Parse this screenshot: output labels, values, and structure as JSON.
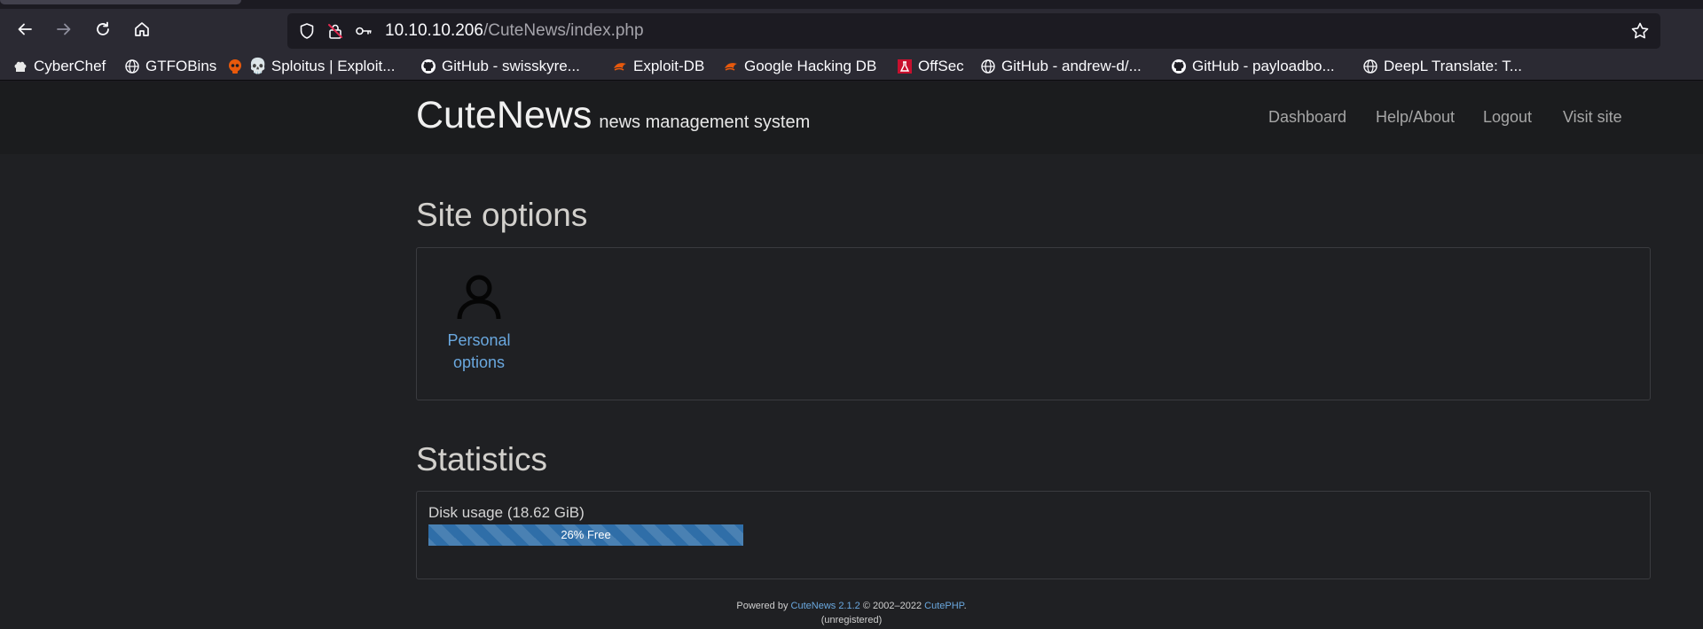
{
  "browser": {
    "url_host": "10.10.10.206",
    "url_path": "/CuteNews/index.php",
    "bookmarks": [
      {
        "label": "CyberChef",
        "icon": "chef-hat-icon"
      },
      {
        "label": "GTFOBins",
        "icon": "globe-icon"
      },
      {
        "label": "💀 Sploitus | Exploit...",
        "icon": "skull-icon"
      },
      {
        "label": "GitHub - swisskyre...",
        "icon": "github-icon"
      },
      {
        "label": "Exploit-DB",
        "icon": "exploit-db-icon"
      },
      {
        "label": "Google Hacking DB",
        "icon": "exploit-db-icon"
      },
      {
        "label": "OffSec",
        "icon": "offsec-icon"
      },
      {
        "label": "GitHub - andrew-d/...",
        "icon": "globe-icon"
      },
      {
        "label": "GitHub - payloadbo...",
        "icon": "github-icon"
      },
      {
        "label": "DeepL Translate: T...",
        "icon": "globe-icon"
      }
    ]
  },
  "header": {
    "brand": "CuteNews",
    "subtitle": "news management system",
    "nav": [
      "Dashboard",
      "Help/About",
      "Logout",
      "Visit site"
    ]
  },
  "site_options": {
    "title": "Site options",
    "items": [
      {
        "label_line1": "Personal",
        "label_line2": "options",
        "icon": "user-icon"
      }
    ]
  },
  "statistics": {
    "title": "Statistics",
    "disk_label": "Disk usage (18.62 GiB)",
    "free_percent": 26,
    "progress_text": "26% Free"
  },
  "footer": {
    "powered_by": "Powered by",
    "product": "CuteNews 2.1.2",
    "copyright": "© 2002–2022",
    "company": "CutePHP",
    "period": ".",
    "status": "(unregistered)"
  },
  "colors": {
    "link": "#6aa8df",
    "progress": "#2f6ea8",
    "page_bg": "#1f2023"
  }
}
